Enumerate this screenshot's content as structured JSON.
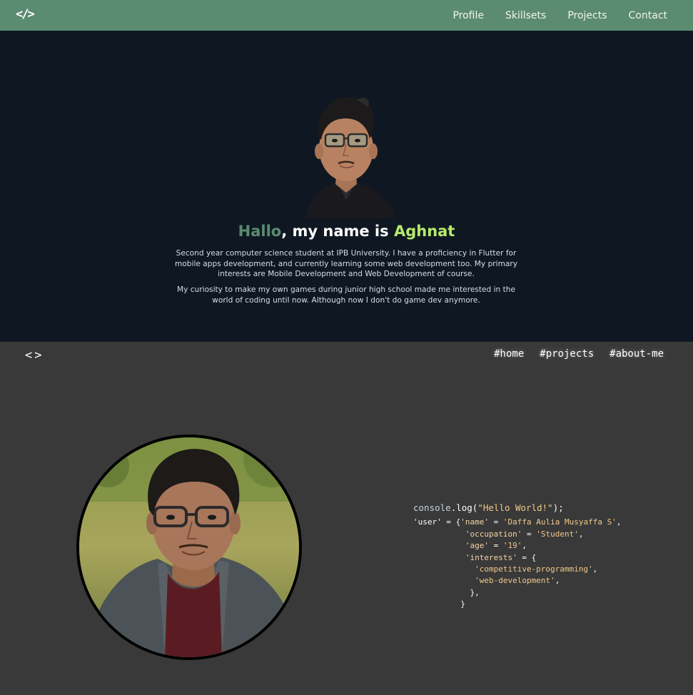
{
  "navbar": {
    "logo_icon": "code-brackets-icon",
    "logo_text": "</>",
    "links": [
      "Profile",
      "Skillsets",
      "Projects",
      "Contact"
    ]
  },
  "hero": {
    "title_hallo": "Hallo",
    "title_middle": ", my name is ",
    "title_name": "Aghnat",
    "paragraph1": "Second year computer science student at IPB University. I have a proficiency in Flutter for mobile apps development, and currently learning some web development too. My primary interests are Mobile Development and Web Development of course.",
    "paragraph2": "My curiosity to make my own games during junior high school made me interested in the world of coding until now. Although now I don't do game dev anymore."
  },
  "section2": {
    "logo_text": "<>",
    "nav": [
      "#home",
      "#projects",
      "#about-me"
    ],
    "code": {
      "line1_fn": "console",
      "line1_method": ".log(",
      "line1_str": "\"Hello World!\"",
      "line1_end": ");",
      "user_key": "'user'",
      "eq_open": " = {",
      "name_key": "'name'",
      "name_val": "'Daffa Aulia Musyaffa S'",
      "occupation_key": "'occupation'",
      "occupation_val": "'Student'",
      "age_key": "'age'",
      "age_val": "'19'",
      "interests_key": "'interests'",
      "interest1": "'competitive-programming'",
      "interest2": "'web-development'",
      "close_inner": "},",
      "close_outer": "}"
    }
  },
  "colors": {
    "navbar_bg": "#5b8b70",
    "hero_bg": "#0f1822",
    "accent_green": "#5b8b70",
    "accent_lime": "#b6ea6c",
    "bottom_bg": "#393939",
    "code_string": "#f1c98b"
  }
}
